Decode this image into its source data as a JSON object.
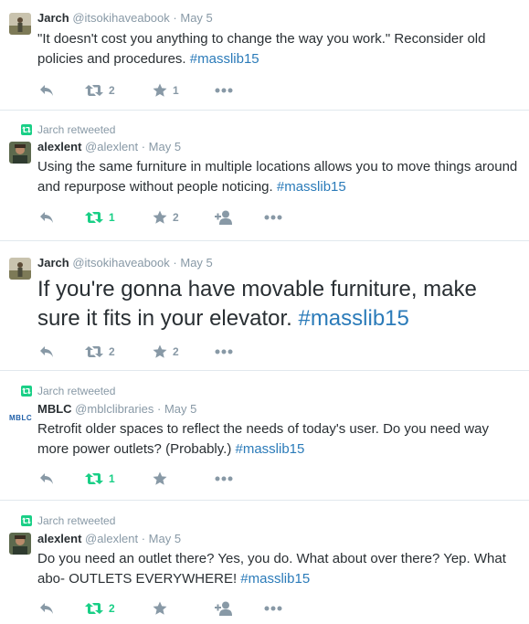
{
  "tweets": [
    {
      "name": "Jarch",
      "handle": "@itsokihaveabook",
      "sep": "·",
      "time": "May 5",
      "text": "\"It doesn't cost you anything to change the way you work.\" Reconsider old policies and procedures. ",
      "hashtag": "#masslib15",
      "retweets": "2",
      "favorites": "1"
    },
    {
      "retweeted_by": "Jarch retweeted",
      "name": "alexlent",
      "handle": "@alexlent",
      "sep": "·",
      "time": "May 5",
      "text": "Using the same furniture in multiple locations allows you to move things around and repurpose without people noticing. ",
      "hashtag": "#masslib15",
      "retweets": "1",
      "favorites": "2"
    },
    {
      "name": "Jarch",
      "handle": "@itsokihaveabook",
      "sep": "·",
      "time": "May 5",
      "text": "If you're gonna have movable furniture, make sure it fits in your elevator. ",
      "hashtag": "#masslib15",
      "retweets": "2",
      "favorites": "2"
    },
    {
      "retweeted_by": "Jarch retweeted",
      "name": "MBLC",
      "handle": "@mblclibraries",
      "sep": "·",
      "time": "May 5",
      "avatar_text": "MBLC",
      "text": "Retrofit older spaces to reflect the needs of today's user. Do you need way more power outlets? (Probably.) ",
      "hashtag": "#masslib15",
      "retweets": "1"
    },
    {
      "retweeted_by": "Jarch retweeted",
      "name": "alexlent",
      "handle": "@alexlent",
      "sep": "·",
      "time": "May 5",
      "text": "Do you need an outlet there? Yes, you do. What about over there? Yep. What abo- OUTLETS EVERYWHERE! ",
      "hashtag": "#masslib15",
      "retweets": "2"
    }
  ],
  "colors": {
    "muted": "#8899a6",
    "link": "#2b7bb9",
    "retweet_green": "#19cf86",
    "divider": "#e1e8ed"
  },
  "icons": [
    "reply-icon",
    "retweet-icon",
    "star-icon",
    "follow-icon",
    "more-icon",
    "avatar-jarch",
    "avatar-alexlent",
    "avatar-mblc"
  ]
}
